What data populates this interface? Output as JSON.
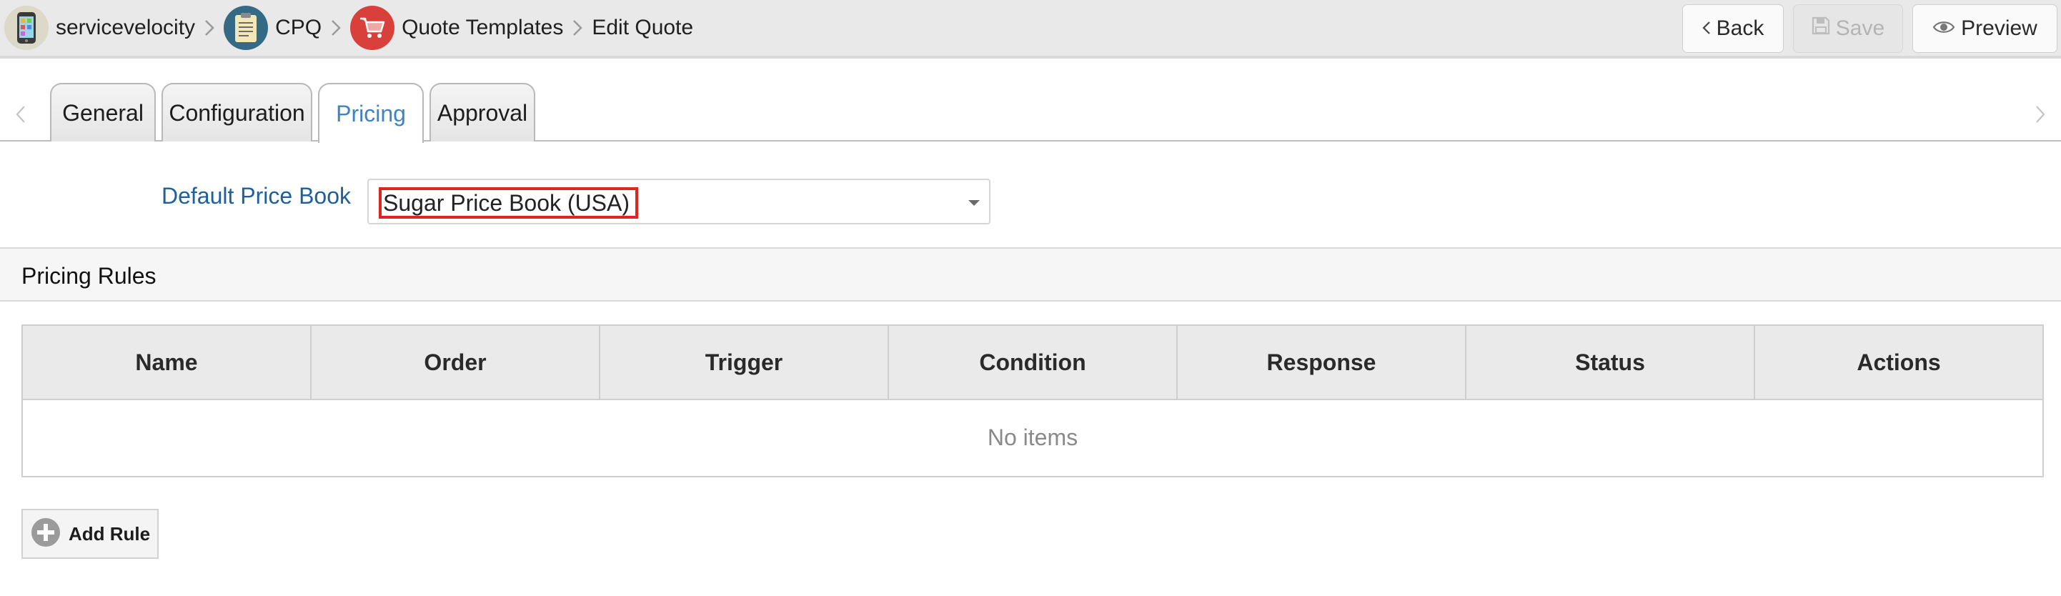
{
  "header": {
    "breadcrumbs": [
      {
        "label": "servicevelocity",
        "icon": "phone-app-icon"
      },
      {
        "label": "CPQ",
        "icon": "clipboard-icon"
      },
      {
        "label": "Quote Templates",
        "icon": "shopping-cart-icon"
      },
      {
        "label": "Edit Quote"
      }
    ],
    "buttons": {
      "back": "Back",
      "save": "Save",
      "preview": "Preview"
    }
  },
  "tabs": [
    {
      "label": "General",
      "active": false
    },
    {
      "label": "Configuration",
      "active": false
    },
    {
      "label": "Pricing",
      "active": true
    },
    {
      "label": "Approval",
      "active": false
    }
  ],
  "pricing": {
    "default_price_book_label": "Default Price Book",
    "default_price_book_value": "Sugar Price Book (USA)"
  },
  "pricing_rules": {
    "title": "Pricing Rules",
    "columns": [
      "Name",
      "Order",
      "Trigger",
      "Condition",
      "Response",
      "Status",
      "Actions"
    ],
    "empty_text": "No items",
    "add_button": "Add Rule"
  },
  "colors": {
    "accent_blue": "#3d84c6",
    "label_blue": "#1e5f9c",
    "highlight_red": "#e0261c",
    "cpq_icon": "#356a84",
    "cart_icon": "#d9403c"
  }
}
